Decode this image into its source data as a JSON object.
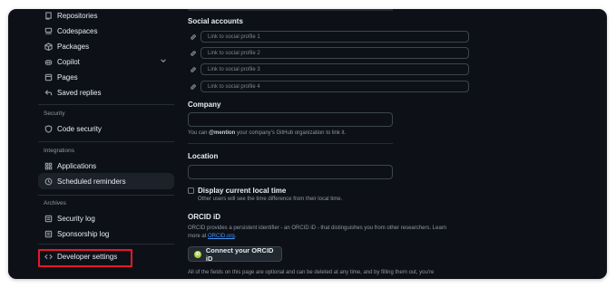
{
  "sidebar": {
    "items_top": [
      {
        "label": "Repositories",
        "icon": "repo-icon"
      },
      {
        "label": "Codespaces",
        "icon": "codespaces-icon"
      },
      {
        "label": "Packages",
        "icon": "package-icon"
      },
      {
        "label": "Copilot",
        "icon": "copilot-icon",
        "expandable": true
      },
      {
        "label": "Pages",
        "icon": "browser-icon"
      },
      {
        "label": "Saved replies",
        "icon": "reply-icon"
      }
    ],
    "security_heading": "Security",
    "security_items": [
      {
        "label": "Code security",
        "icon": "shield-lock-icon"
      }
    ],
    "integrations_heading": "Integrations",
    "integrations_items": [
      {
        "label": "Applications",
        "icon": "apps-icon"
      },
      {
        "label": "Scheduled reminders",
        "icon": "clock-icon",
        "active": true
      }
    ],
    "archives_heading": "Archives",
    "archives_items": [
      {
        "label": "Security log",
        "icon": "log-icon"
      },
      {
        "label": "Sponsorship log",
        "icon": "log-icon"
      }
    ],
    "developer_settings": {
      "label": "Developer settings",
      "icon": "code-icon",
      "highlighted": true
    }
  },
  "main": {
    "social": {
      "heading": "Social accounts",
      "placeholders": [
        "Link to social profile 1",
        "Link to social profile 2",
        "Link to social profile 3",
        "Link to social profile 4"
      ]
    },
    "company": {
      "heading": "Company",
      "value": "",
      "note_prefix": "You can ",
      "note_mention": "@mention",
      "note_suffix": " your company's GitHub organization to link it."
    },
    "location": {
      "heading": "Location",
      "value": ""
    },
    "local_time": {
      "label": "Display current local time",
      "checked": false,
      "note": "Other users will see the time difference from their local time."
    },
    "orcid": {
      "heading": "ORCID iD",
      "description": "ORCID provides a persistent identifier - an ORCID iD - that distinguishes you from other researchers. Learn",
      "description_line2_prefix": "more at ",
      "link": "ORCID.org",
      "description_line2_suffix": ".",
      "button_label": "Connect your ORCID iD",
      "button_icon_text": "iD"
    },
    "footer_note": "All of the fields on this page are optional and can be deleted at any time, and by filling them out, you're"
  },
  "colors": {
    "background": "#0d1117",
    "border": "#3d444d",
    "muted": "#9198a1",
    "link": "#4493f8",
    "highlight_box": "#e5182b",
    "orcid_green": "#a6ce39"
  }
}
